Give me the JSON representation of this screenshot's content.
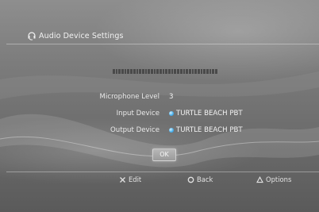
{
  "header": {
    "title": "Audio Device Settings",
    "icon": "headset-icon"
  },
  "meter": {
    "segments": 36,
    "level_fraction": 0.0
  },
  "settings": {
    "rows": [
      {
        "label": "Microphone Level",
        "value": "3"
      },
      {
        "label": "Input Device",
        "value": "TURTLE BEACH PBT"
      },
      {
        "label": "Output Device",
        "value": "TURTLE BEACH PBT"
      }
    ]
  },
  "ok_button": {
    "label": "OK"
  },
  "footer": {
    "edit": {
      "label": "Edit",
      "icon": "cross-button-icon"
    },
    "back": {
      "label": "Back",
      "icon": "circle-button-icon"
    },
    "options": {
      "label": "Options",
      "icon": "triangle-button-icon"
    }
  },
  "colors": {
    "accent": "#3aa6e8",
    "text": "#f0f0f0"
  }
}
